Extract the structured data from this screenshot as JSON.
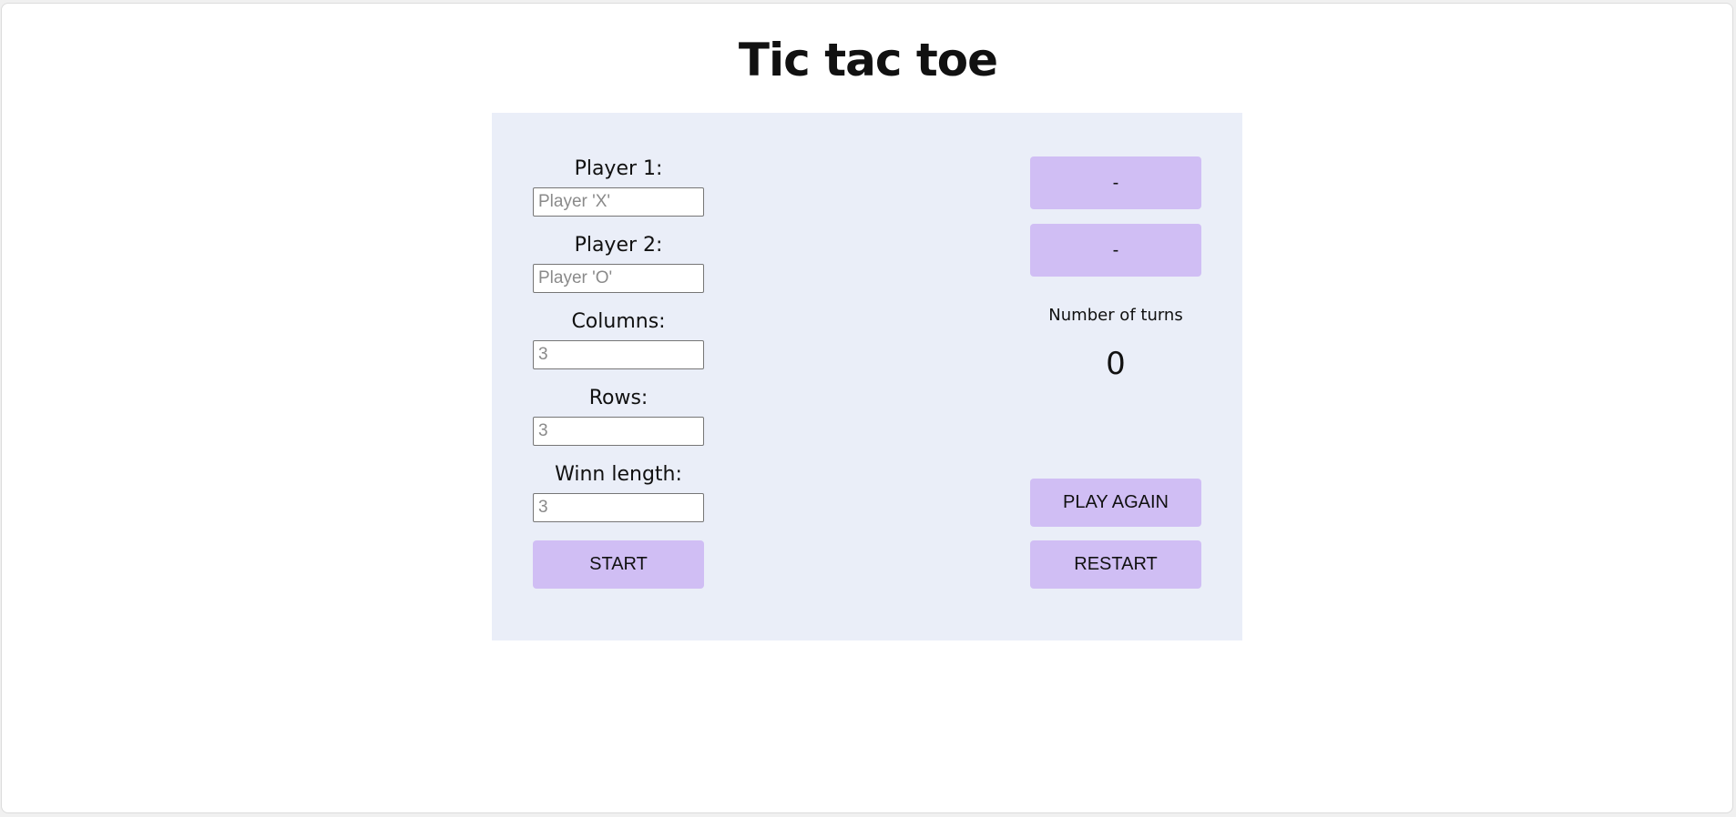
{
  "title": "Tic tac toe",
  "setup": {
    "player1_label": "Player 1:",
    "player1_placeholder": "Player 'X'",
    "player2_label": "Player 2:",
    "player2_placeholder": "Player 'O'",
    "columns_label": "Columns:",
    "columns_placeholder": "3",
    "rows_label": "Rows:",
    "rows_placeholder": "3",
    "win_length_label": "Winn length:",
    "win_length_placeholder": "3",
    "start_label": "START"
  },
  "status": {
    "player1_slot": "-",
    "player2_slot": "-",
    "turns_label": "Number of turns",
    "turns_value": "0",
    "play_again_label": "PLAY AGAIN",
    "restart_label": "RESTART"
  },
  "colors": {
    "panel_background": "#eaeef8",
    "button_background": "#d0bef4"
  }
}
